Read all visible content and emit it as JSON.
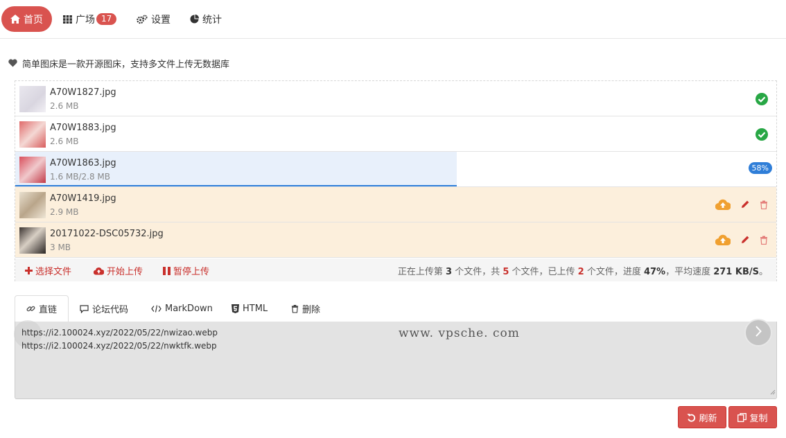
{
  "nav": {
    "items": [
      {
        "label": "首页",
        "icon": "home-icon",
        "active": true
      },
      {
        "label": "广场",
        "icon": "grid-icon",
        "badge": "17"
      },
      {
        "label": "设置",
        "icon": "gears-icon"
      },
      {
        "label": "统计",
        "icon": "pie-chart-icon"
      }
    ]
  },
  "notice": {
    "text": "简单图床是一款开源图床，支持多文件上传无数据库"
  },
  "files": [
    {
      "name": "A70W1827.jpg",
      "size": "2.6 MB",
      "status": "done"
    },
    {
      "name": "A70W1883.jpg",
      "size": "2.6 MB",
      "status": "done"
    },
    {
      "name": "A70W1863.jpg",
      "size": "1.6 MB/2.8 MB",
      "status": "uploading",
      "progress": 58,
      "progress_label": "58%"
    },
    {
      "name": "A70W1419.jpg",
      "size": "2.9 MB",
      "status": "pending"
    },
    {
      "name": "20171022-DSC05732.jpg",
      "size": "3 MB",
      "status": "pending"
    }
  ],
  "toolbar": {
    "choose_label": "选择文件",
    "start_label": "开始上传",
    "pause_label": "暂停上传",
    "stats": {
      "t1": "正在上传第 ",
      "current": "3",
      "t2": " 个文件，共 ",
      "total": "5",
      "t3": " 个文件，已上传 ",
      "uploaded": "2",
      "t4": " 个文件，进度 ",
      "progress": "47%",
      "t5": "，平均速度 ",
      "speed": "271 KB/S",
      "t6": "。"
    }
  },
  "tabs": [
    {
      "label": "直链",
      "icon": "link-icon",
      "active": true
    },
    {
      "label": "论坛代码",
      "icon": "comment-icon"
    },
    {
      "label": "MarkDown",
      "icon": "code-icon"
    },
    {
      "label": "HTML",
      "icon": "html5-icon"
    },
    {
      "label": "删除",
      "icon": "trash-icon"
    }
  ],
  "output": {
    "lines": [
      "https://i2.100024.xyz/2022/05/22/nwizao.webp",
      "https://i2.100024.xyz/2022/05/22/nwktfk.webp"
    ],
    "watermark": "www. vpsche. com"
  },
  "buttons": {
    "refresh_label": "刷新",
    "copy_label": "复制"
  },
  "colors": {
    "accent": "#d9534f",
    "success": "#28a745",
    "progress": "#2f7ed8",
    "pending_bg": "#fcefdc",
    "upload_icon": "#f0a030"
  }
}
